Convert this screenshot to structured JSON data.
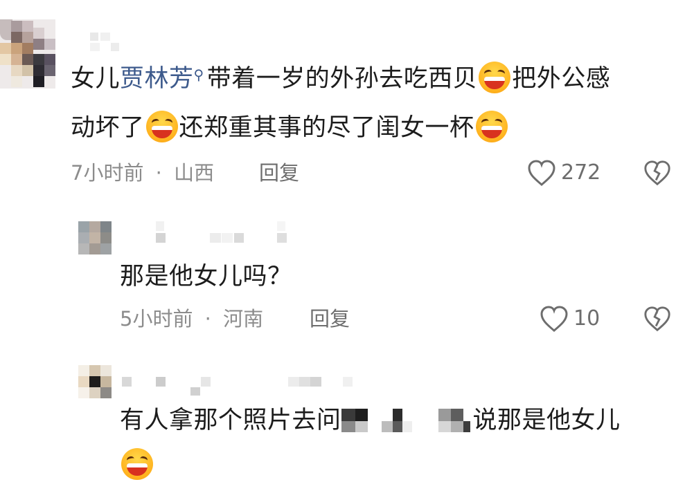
{
  "comments": [
    {
      "text_prefix": "女儿",
      "mention": "贾林芳",
      "text_part1": "带着一岁的外孙去吃西贝",
      "text_part2": "把外公感",
      "line2_part1": "动坏了",
      "line2_part2": "还郑重其事的尽了闺女一杯",
      "time": "7小时前",
      "location": "山西",
      "reply_label": "回复",
      "likes": "272"
    },
    {
      "text": "那是他女儿吗？",
      "time": "5小时前",
      "location": "河南",
      "reply_label": "回复",
      "likes": "10"
    },
    {
      "text_part1": "有人拿那个照片去问",
      "text_part2": "说那是他女儿"
    }
  ],
  "separator": "·",
  "icons": {
    "mention": "magnifier-mention-icon",
    "emoji": "laughing-emoji-icon",
    "like": "heart-outline-icon",
    "dislike": "broken-heart-icon"
  },
  "colors": {
    "mention": "#3d5a8c",
    "meta": "#8c8c8c",
    "emoji": "#ffb21e"
  }
}
